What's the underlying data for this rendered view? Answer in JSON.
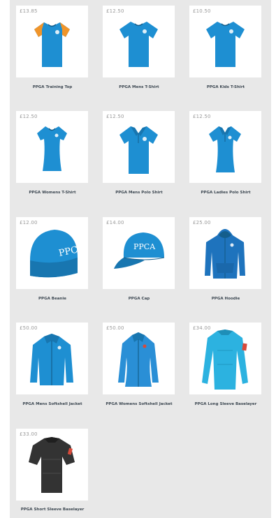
{
  "products": [
    {
      "name": "PPGA Training Top",
      "price": "£13.85",
      "icon": "training-top-image"
    },
    {
      "name": "PPGA Mens T-Shirt",
      "price": "£12.50",
      "icon": "mens-tshirt-image"
    },
    {
      "name": "PPGA Kids T-Shirt",
      "price": "£10.50",
      "icon": "kids-tshirt-image"
    },
    {
      "name": "PPGA Womens T-Shirt",
      "price": "£12.50",
      "icon": "womens-tshirt-image"
    },
    {
      "name": "PPGA Mens Polo Shirt",
      "price": "£12.50",
      "icon": "mens-polo-image"
    },
    {
      "name": "PPGA Ladies Polo Shirt",
      "price": "£12.50",
      "icon": "ladies-polo-image"
    },
    {
      "name": "PPGA Beanie",
      "price": "£12.00",
      "icon": "beanie-image",
      "logo_text": "PPCA"
    },
    {
      "name": "PPGA Cap",
      "price": "£14.00",
      "icon": "cap-image",
      "logo_text": "PPCA"
    },
    {
      "name": "PPGA Hoodie",
      "price": "£25.00",
      "icon": "hoodie-image"
    },
    {
      "name": "PPGA Mens Softshell Jacket",
      "price": "£50.00",
      "icon": "mens-softshell-image"
    },
    {
      "name": "PPGA Womens Softshell Jacket",
      "price": "£50.00",
      "icon": "womens-softshell-image"
    },
    {
      "name": "PPGA Long Sleeve Baselayer",
      "price": "£34.00",
      "icon": "long-sleeve-baselayer-image"
    },
    {
      "name": "PPGA Short Sleeve Baselayer",
      "price": "£33.00",
      "icon": "short-sleeve-baselayer-image"
    }
  ],
  "colors": {
    "product_blue": "#1e8fd2",
    "baselayer_cyan": "#2cb2e0",
    "baselayer_black": "#333333",
    "accent_orange": "#f0952a",
    "panel_bg": "#e8e8e8"
  }
}
